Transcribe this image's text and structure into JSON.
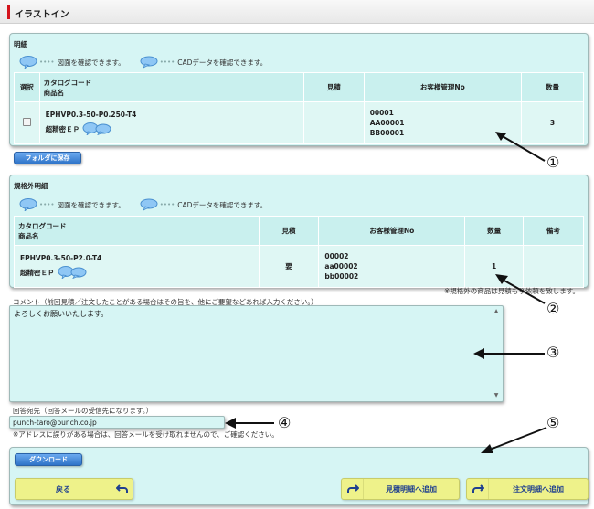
{
  "header": {
    "title": "イラストイン"
  },
  "legend": {
    "drawing_text": "図面を確認できます。",
    "cad_text": "CADデータを確認できます。",
    "dots": "••••"
  },
  "section1": {
    "title": "明細",
    "headers": {
      "select": "選択",
      "catalog_code": "カタログコード",
      "product_name": "商品名",
      "estimate": "見積",
      "customer_no": "お客様管理No",
      "quantity": "数量"
    },
    "row": {
      "code": "EPHVP0.3-50-P0.250-T4",
      "name": "超精密ＥＰ",
      "estimate": "",
      "customer_no_1": "00001",
      "customer_no_2": "AA00001",
      "customer_no_3": "BB00001",
      "quantity": "3"
    },
    "save_button": "フォルダに保存"
  },
  "section2": {
    "title": "規格外明細",
    "headers": {
      "catalog_code": "カタログコード",
      "product_name": "商品名",
      "estimate": "見積",
      "customer_no": "お客様管理No",
      "quantity": "数量",
      "remarks": "備考"
    },
    "row": {
      "code": "EPHVP0.3-50-P2.0-T4",
      "name": "超精密ＥＰ",
      "estimate": "要",
      "customer_no_1": "00002",
      "customer_no_2": "aa00002",
      "customer_no_3": "bb00002",
      "quantity": "1",
      "remarks": ""
    },
    "note": "※規格外の商品は見積もり依頼を致します。"
  },
  "comment": {
    "label": "コメント（前回見積／注文したことがある場合はその旨を、他にご要望などあれば入力ください。）",
    "value": "よろしくお願いいたします。"
  },
  "email": {
    "label": "回答宛先（回答メールの受信先になります。）",
    "value": "punch-taro@punch.co.jp",
    "note": "※アドレスに誤りがある場合は、回答メールを受け取れませんので、ご確認ください。"
  },
  "actions": {
    "download": "ダウンロード",
    "back": "戻る",
    "add_estimate": "見積明細へ追加",
    "add_order": "注文明細へ追加"
  },
  "annotations": {
    "n1": "①",
    "n2": "②",
    "n3": "③",
    "n4": "④",
    "n5": "⑤"
  },
  "colors": {
    "panel_bg": "#d6f5f4",
    "header_bar": "#d4141c",
    "button_blue": "#2f74c8",
    "button_yellow": "#eef28a"
  }
}
